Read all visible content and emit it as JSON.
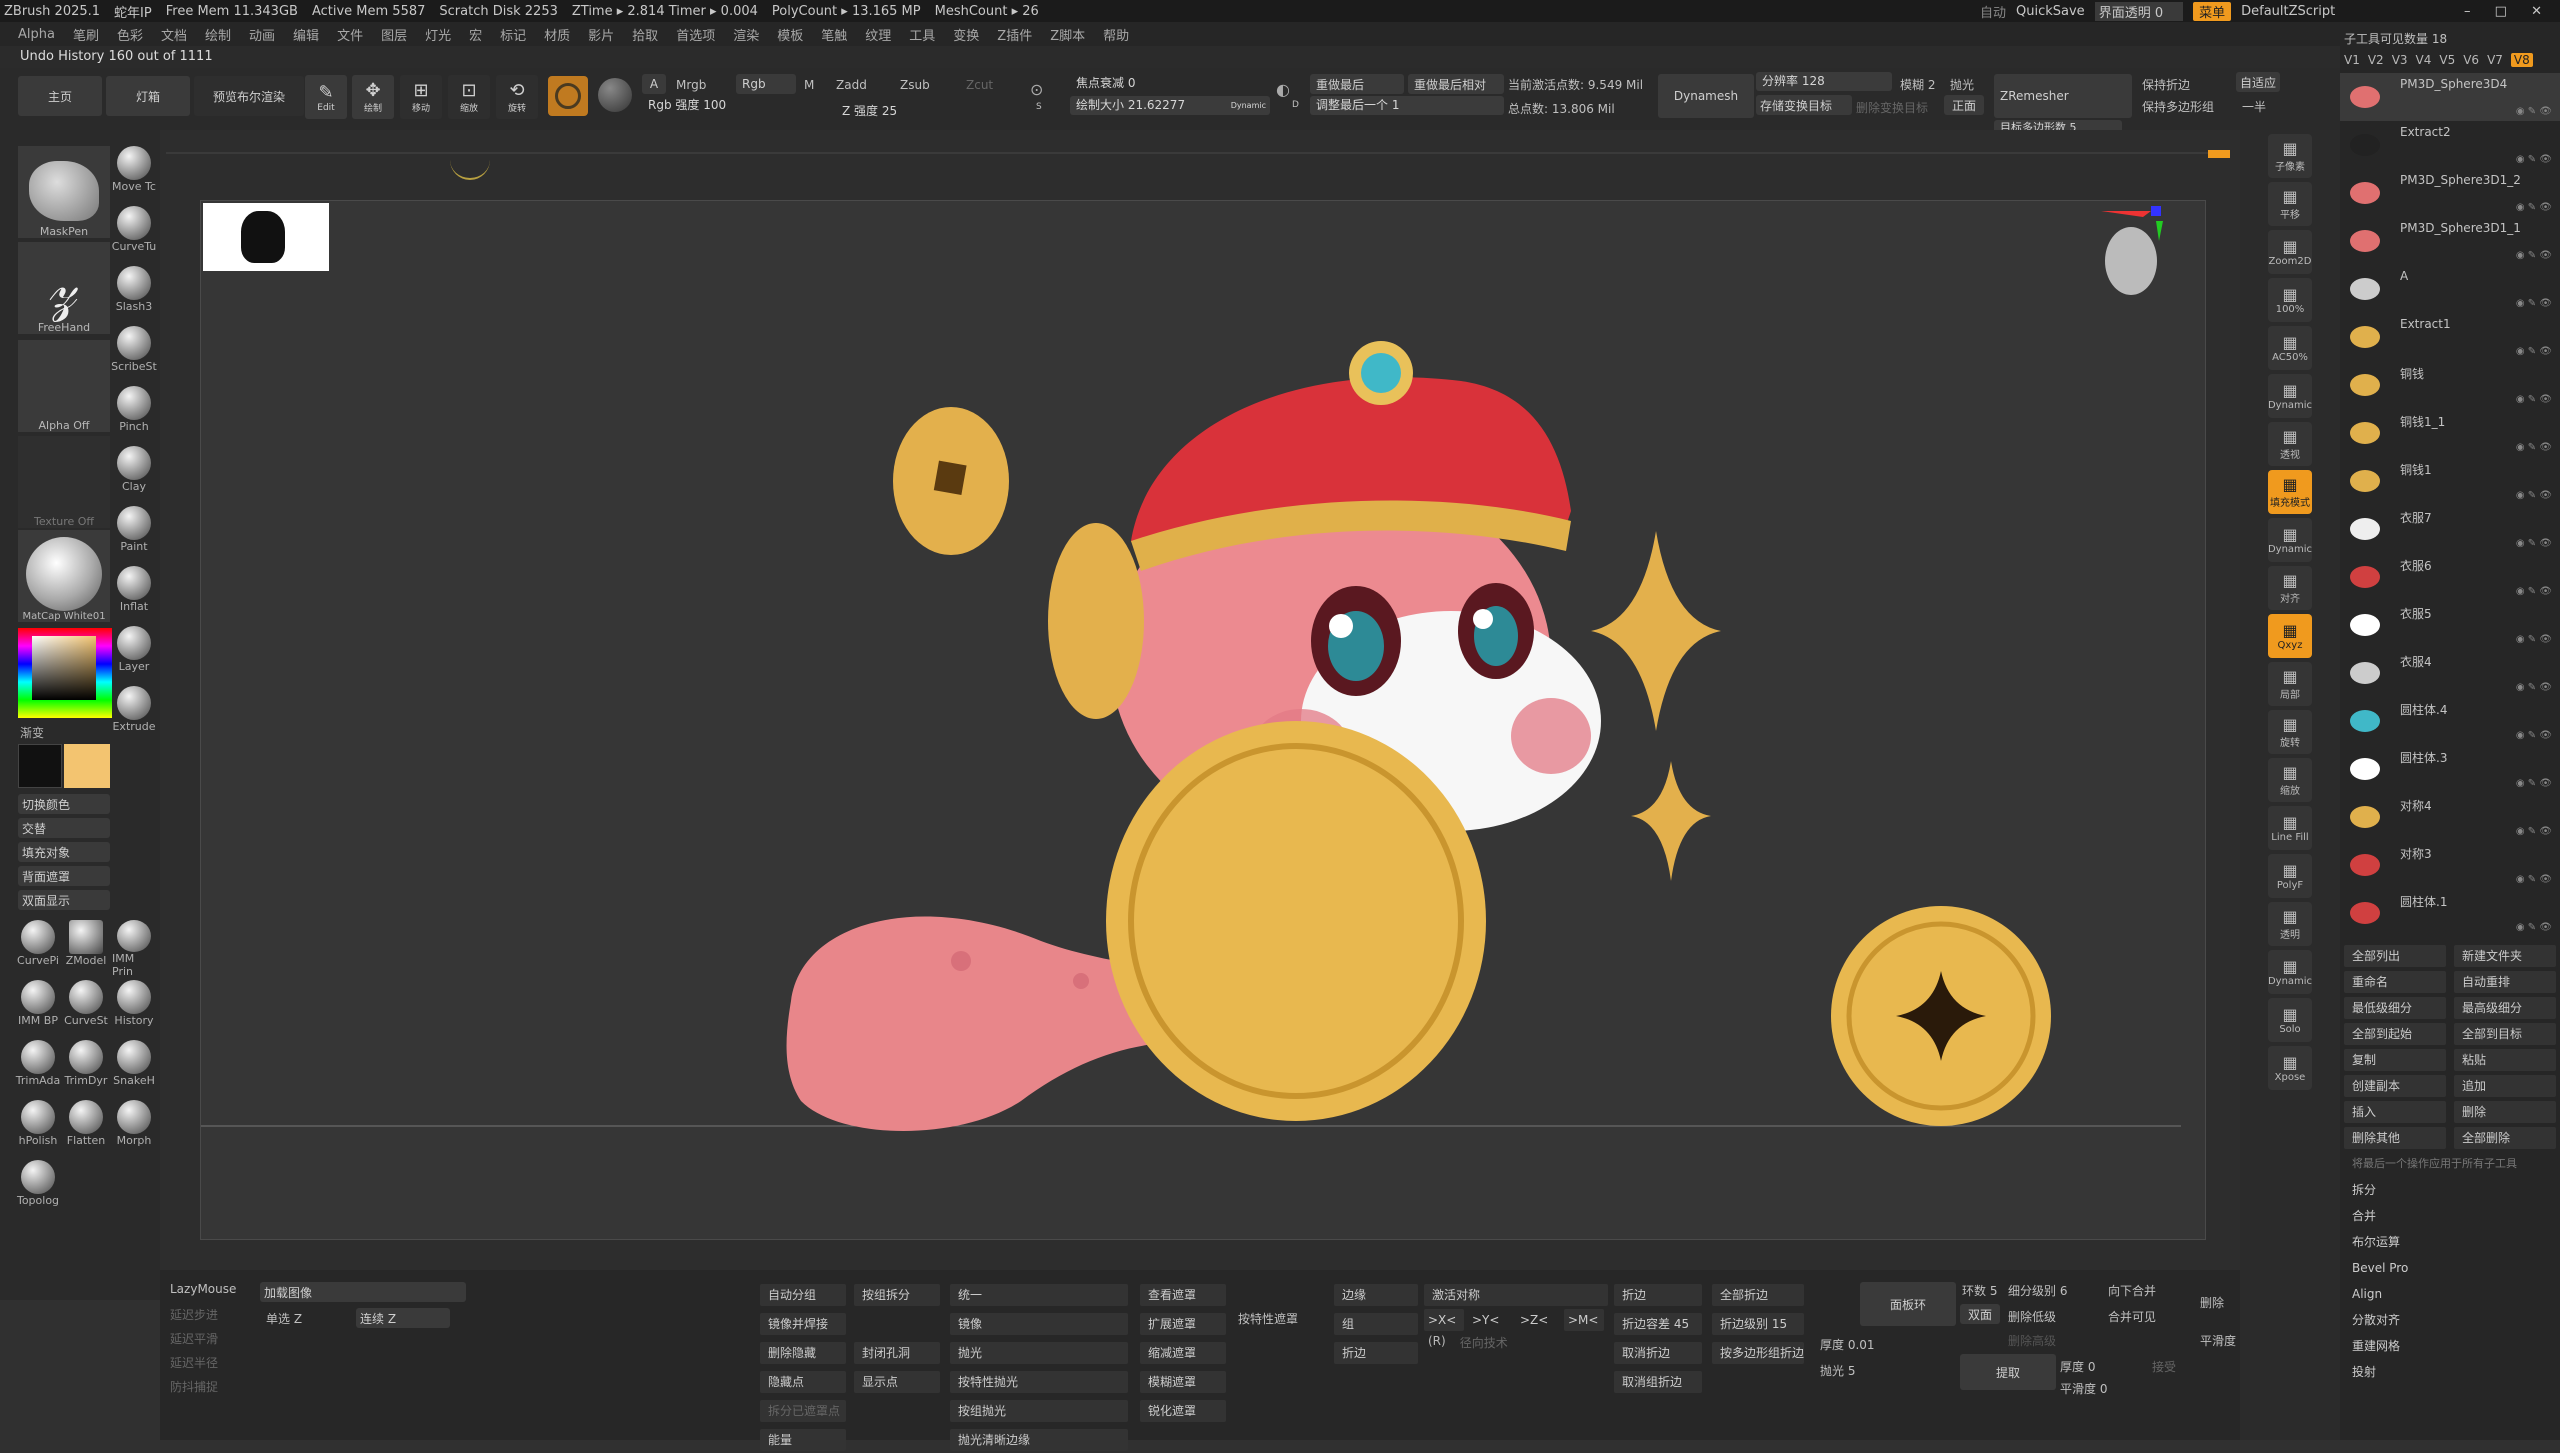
{
  "app": {
    "title": "ZBrush 2025.1",
    "user": "蛇年IP",
    "free_mem": "Free Mem 11.343GB",
    "active_mem": "Active Mem 5587",
    "scratch": "Scratch Disk 2253",
    "ztime": "ZTime ▸ 2.814 Timer ▸ 0.004",
    "polycount": "PolyCount ▸ 13.165 MP",
    "meshcount": "MeshCount ▸ 26"
  },
  "topright": {
    "auto": "自动",
    "quicksave": "QuickSave",
    "ui_transparency": "界面透明 0",
    "menu": "菜单",
    "script": "DefaultZScript"
  },
  "menu": [
    "Alpha",
    "笔刷",
    "色彩",
    "文档",
    "绘制",
    "动画",
    "编辑",
    "文件",
    "图层",
    "灯光",
    "宏",
    "标记",
    "材质",
    "影片",
    "拾取",
    "首选项",
    "渲染",
    "模板",
    "笔触",
    "纹理",
    "工具",
    "变换",
    "Z插件",
    "Z脚本",
    "帮助"
  ],
  "undo": "Undo History 160 out of 1111",
  "shelf": {
    "home": "主页",
    "lightbox": "灯箱",
    "bpr": "预览布尔渲染",
    "edit": "Edit",
    "draw": "绘制",
    "move": "移动",
    "scale": "缩放",
    "rotate": "旋转",
    "a_label": "A",
    "mrgb": "Mrgb",
    "rgb": "Rgb",
    "m": "M",
    "zadd": "Zadd",
    "zsub": "Zsub",
    "zcut": "Zcut",
    "rgb_intensity": "Rgb 强度 100",
    "z_intensity": "Z 强度 25",
    "focal": "焦点衰减 0",
    "draw_size": "绘制大小 21.62277",
    "dynamic": "Dynamic",
    "s_label": "S",
    "d_label": "D",
    "replay_last": "重做最后",
    "replay_last_rel": "重做最后相对",
    "adjust_last": "调整最后一个 1",
    "active_points": "当前激活点数: 9.549 Mil",
    "total_points": "总点数: 13.806 Mil",
    "dynamesh": "Dynamesh",
    "resolution": "分辨率 128",
    "blur": "模糊 2",
    "polish": "抛光",
    "store_morph": "存储变换目标",
    "delete_morph": "删除变换目标",
    "front": "正面",
    "zremesher": "ZRemesher",
    "keep_creases": "保持折边",
    "keep_groups": "保持多边形组",
    "adaptive": "自适应",
    "half": "一半",
    "target_poly": "目标多边形数 5"
  },
  "left": {
    "brushes": [
      {
        "name": "MaskPen"
      },
      {
        "name": "Move Tc"
      },
      {
        "name": "CurveTu"
      },
      {
        "name": "FreeHand"
      },
      {
        "name": "Slash3"
      },
      {
        "name": "ScribeSt"
      },
      {
        "name": "Pinch"
      },
      {
        "name": "Alpha Off"
      },
      {
        "name": "Clay"
      },
      {
        "name": "Paint"
      },
      {
        "name": "Texture Off"
      },
      {
        "name": "Inflat"
      },
      {
        "name": "Layer"
      },
      {
        "name": "MatCap White01"
      },
      {
        "name": "Extrude"
      }
    ],
    "gradient": "渐变",
    "switch_color": "切换颜色",
    "alternate": "交替",
    "fill_object": "填充对象",
    "backface_mask": "背面遮罩",
    "double_sided": "双面显示",
    "bottom_brushes": [
      "CurvePi",
      "ZModel",
      "IMM Prin",
      "IMM BP",
      "CurveSt",
      "History",
      "TrimAda",
      "TrimDyr",
      "SnakeH",
      "hPolish",
      "Flatten",
      "Morph",
      "Topolog"
    ],
    "primary_color": "#111111",
    "secondary_color": "#f3c470"
  },
  "bottom": {
    "lazymouse": "LazyMouse",
    "lazystep": "延迟步进",
    "lazysmooth": "延迟平滑",
    "lazyradius": "延迟半径",
    "backtrack": "防抖捕捉",
    "load_image": "加载图像",
    "single_z": "单选 Z",
    "continuous_z": "连续 Z",
    "col1": [
      "自动分组",
      "镜像并焊接",
      "删除隐藏",
      "隐藏点",
      "拆分已遮罩点",
      "能量"
    ],
    "col2": [
      "按组拆分",
      "封闭孔洞",
      "显示点"
    ],
    "col3": [
      "统一",
      "镜像",
      "抛光",
      "按特性抛光",
      "按组抛光",
      "抛光清晰边缘"
    ],
    "col4": [
      "查看遮罩",
      "扩展遮罩",
      "缩减遮罩",
      "模糊遮罩",
      "锐化遮罩"
    ],
    "col5": "按特性遮罩",
    "col6": [
      "边缘",
      "组",
      "折边"
    ],
    "col7": [
      "激活对称",
      ">X<",
      ">Y<",
      ">Z<",
      ">M<",
      "(R)",
      "径向技术"
    ],
    "col8": [
      "折边",
      "折边容差 45",
      "取消折边",
      "取消组折边"
    ],
    "col9": [
      "全部折边",
      "折边级别 15",
      "按多边形组折边"
    ],
    "panel_loop": "面板环",
    "loops": "环数 5",
    "subdiv": "细分级别 6",
    "double": "双面",
    "delete_low": "删除低级",
    "delete_high": "删除高级",
    "merge_down": "向下合并",
    "merge_visible": "合并可见",
    "delete": "删除",
    "polish": "抛光 5",
    "thickness": "厚度 0.01",
    "extract": "提取",
    "accept": "接受",
    "thickness0": "厚度 0",
    "smooth": "平滑度 0",
    "smooth2": "平滑度"
  },
  "rightshelf": [
    "子像素",
    "平移",
    "Zoom2D",
    "100%",
    "AC50%",
    "Dynamic",
    "透视",
    "填充模式",
    "Dynamic",
    "对齐",
    "Qxyz",
    "局部",
    "旋转",
    "缩放",
    "Line Fill",
    "PolyF",
    "透明",
    "Dynamic",
    "Solo",
    "Xpose"
  ],
  "subtool": {
    "header": "子工具可见数量 18",
    "versions": [
      "V1",
      "V2",
      "V3",
      "V4",
      "V5",
      "V6",
      "V7",
      "V8"
    ],
    "items": [
      "PM3D_Sphere3D4",
      "Extract2",
      "PM3D_Sphere3D1_2",
      "PM3D_Sphere3D1_1",
      "A",
      "Extract1",
      "铜钱",
      "铜钱1_1",
      "铜钱1",
      "衣服7",
      "衣服6",
      "衣服5",
      "衣服4",
      "圆柱体.4",
      "圆柱体.3",
      "对称4",
      "对称3",
      "圆柱体.1"
    ],
    "actions": [
      "全部列出",
      "新建文件夹",
      "重命名",
      "自动重排",
      "最低级细分",
      "最高级细分",
      "全部到起始",
      "全部到目标",
      "复制",
      "粘贴",
      "创建副本",
      "追加",
      "插入",
      "删除",
      "删除其他",
      "全部删除",
      "将最后一个操作应用于所有子工具",
      "拆分",
      "合并",
      "布尔运算",
      "Bevel Pro",
      "Align",
      "分散对齐",
      "重建网格",
      "投射"
    ]
  }
}
